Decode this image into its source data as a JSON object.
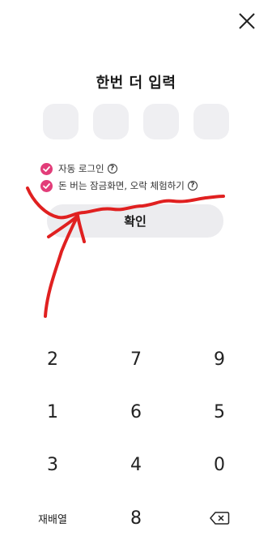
{
  "title": "한번 더 입력",
  "options": {
    "auto_login": "자동 로그인",
    "locked_hint": "돈 버는 잠금화면, 오락 체험하기",
    "help_glyph": "?"
  },
  "confirm_label": "확인",
  "keypad": {
    "row1": [
      "2",
      "7",
      "9"
    ],
    "row2": [
      "1",
      "6",
      "5"
    ],
    "row3": [
      "3",
      "4",
      "0"
    ],
    "shuffle_label": "재배열",
    "last_digit": "8"
  },
  "colors": {
    "accent": "#e23d79",
    "pin_box": "#efeff2",
    "button_bg": "#ececef",
    "annotation": "#e02020"
  },
  "icons": {
    "close": "close-icon",
    "check": "check-icon",
    "help": "help-icon",
    "backspace": "backspace-icon"
  }
}
